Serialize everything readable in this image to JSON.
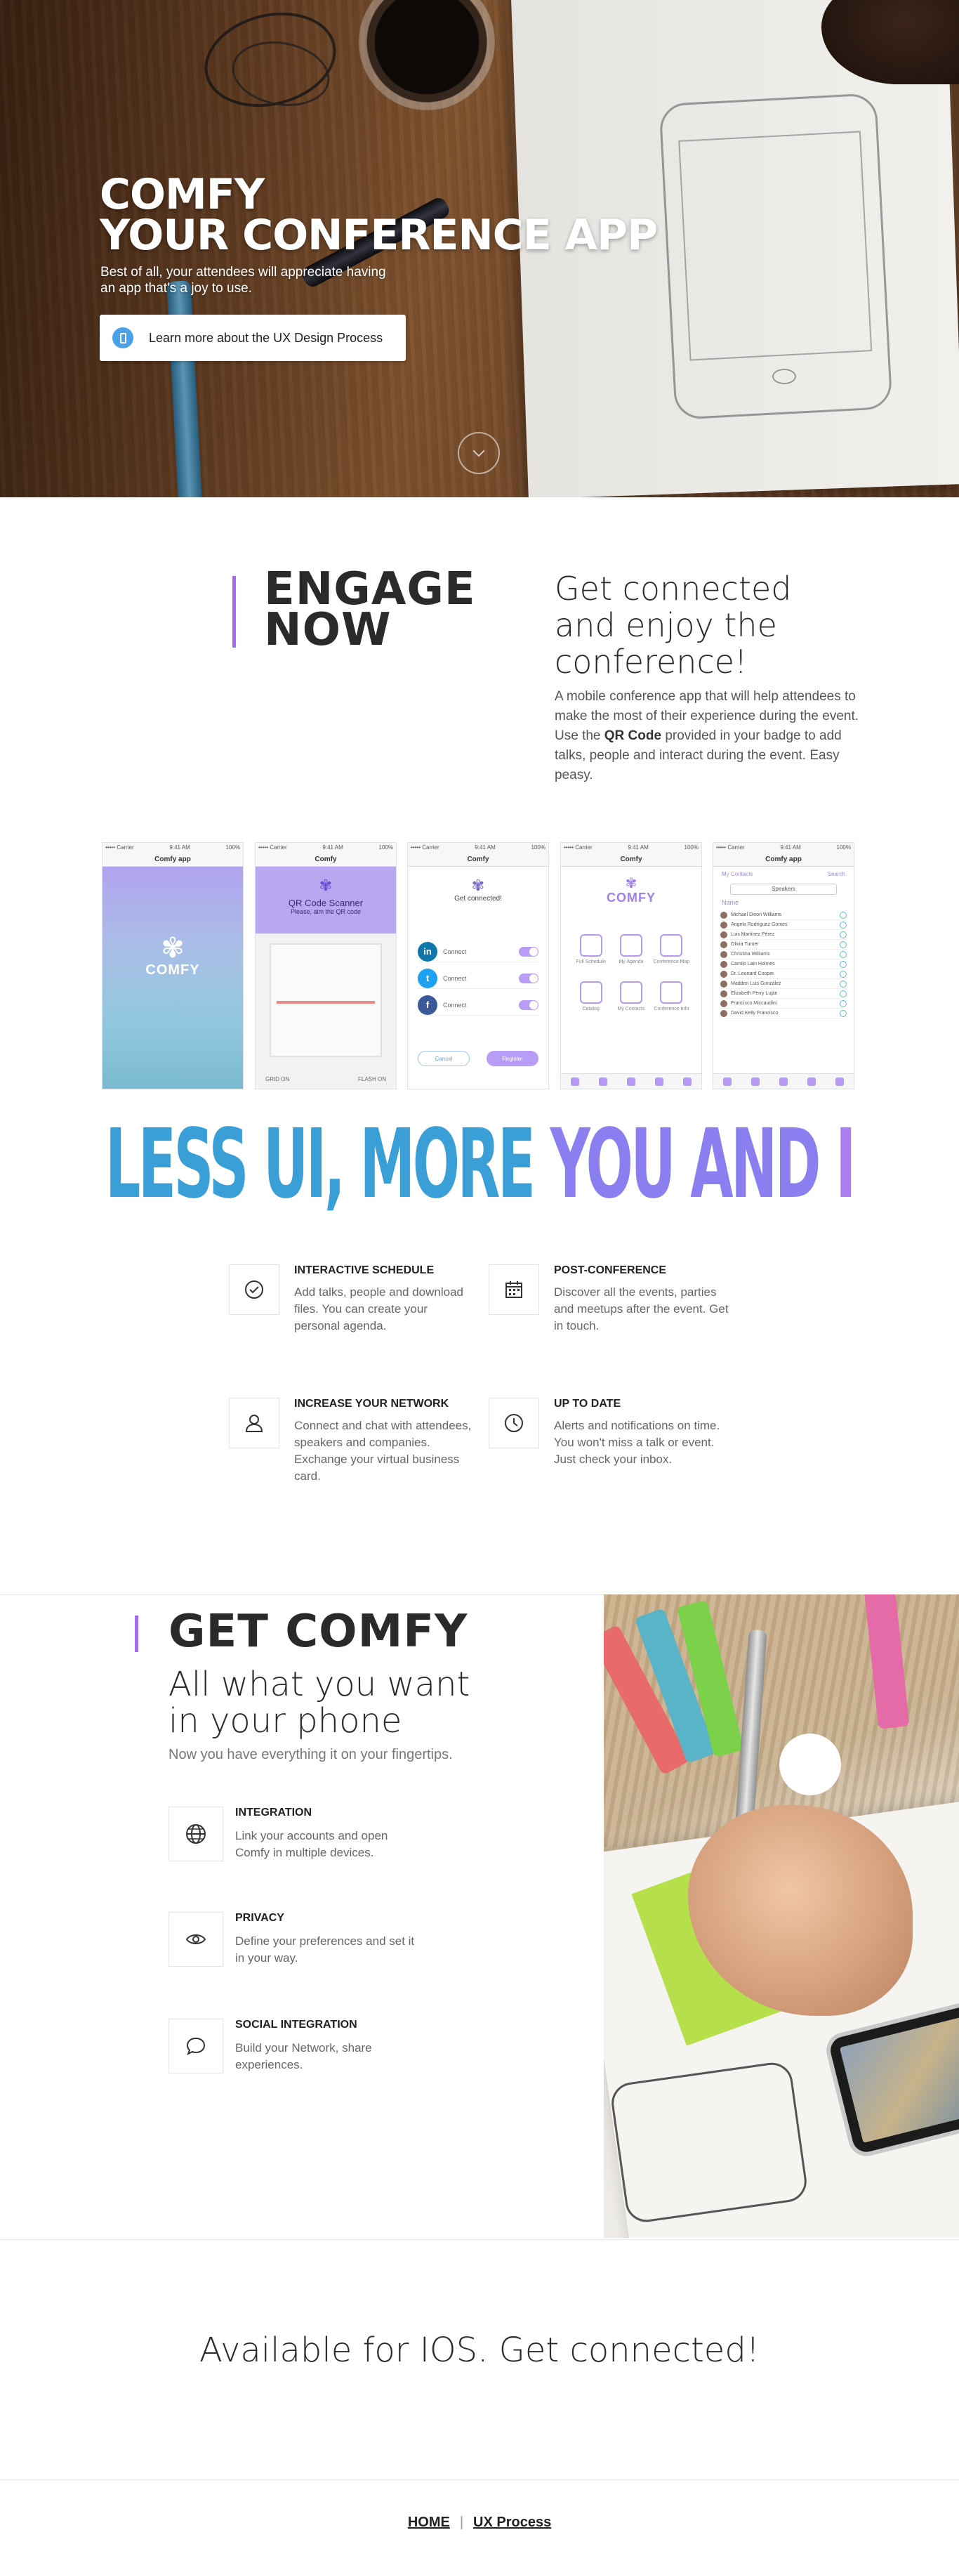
{
  "hero": {
    "title_line1": "COMFY",
    "title_line2": "YOUR CONFERENCE APP",
    "subtitle": "Best of all, your attendees will appreciate having an app that's a joy to use.",
    "cta_label": "Learn more about the UX Design Process",
    "cta_icon": "mobile-phone-icon",
    "scroll_icon": "chevron-down-icon"
  },
  "engage": {
    "title_line1": "ENGAGE",
    "title_line2": "NOW",
    "heading": "Get connected and enjoy the conference!",
    "text_before": "A mobile conference app that will help attendees to make the most of their experience during the event. Use the ",
    "text_bold": "QR Code",
    "text_after": " provided in your badge to add talks, people and interact during the event. Easy peasy.",
    "accent_color": "#a36cf0"
  },
  "screens": {
    "splash": {
      "status_left": "••••• Carrier",
      "status_time": "9:41 AM",
      "status_right": "100%",
      "nav_title": "Comfy app",
      "brand": "COMFY"
    },
    "scanner": {
      "status_left": "••••• Carrier",
      "status_time": "9:41 AM",
      "status_right": "100%",
      "nav_title": "Comfy",
      "title": "QR Code Scanner",
      "subtitle": "Please, aim the QR code",
      "left_action": "GRID ON",
      "right_action": "FLASH ON"
    },
    "connect": {
      "status_left": "••••• Carrier",
      "status_time": "9:41 AM",
      "status_right": "100%",
      "nav_title": "Comfy",
      "heading": "Get connected!",
      "rows": [
        {
          "network": "in",
          "label": "Connect",
          "color": "#0e76a8"
        },
        {
          "network": "t",
          "label": "Connect",
          "color": "#1da1f2"
        },
        {
          "network": "f",
          "label": "Connect",
          "color": "#3b5998"
        }
      ],
      "cancel": "Cancel",
      "register": "Register"
    },
    "home": {
      "status_left": "••••• Carrier",
      "status_time": "9:41 AM",
      "status_right": "100%",
      "nav_title": "Comfy",
      "brand": "COMFY",
      "tiles": [
        "Full Schedule",
        "My Agenda",
        "Conference Map",
        "Catalog",
        "My Contacts",
        "Conference Info"
      ]
    },
    "contacts": {
      "status_left": "••••• Carrier",
      "status_time": "9:41 AM",
      "status_right": "100%",
      "nav_title": "Comfy app",
      "search_label": "My Contacts",
      "search_right": "Search",
      "segment": "Speakers",
      "list_header": "Name",
      "people": [
        "Michael Dixon Williams",
        "Angela Rodríguez Gomes",
        "Luis Martínez Pérez",
        "Olivia Turner",
        "Christina Williams",
        "Camilo Lain Holmes",
        "Dr. Leonard Cooper",
        "Madden Luis González",
        "Elizabeth Perry Luján",
        "Francisco Miccaudini",
        "David Kelly Francisco"
      ]
    }
  },
  "slogan": {
    "part1": "LESS UI, MORE ",
    "part2": "YOU AND ",
    "part3": "I",
    "color1": "#3a9fd6",
    "color2": "#8a7ef0",
    "color3": "#a87ef0"
  },
  "features": [
    {
      "icon": "check-circle-icon",
      "title": "INTERACTIVE SCHEDULE",
      "text": "Add talks, people and download files. You can create your personal agenda."
    },
    {
      "icon": "calendar-icon",
      "title": "POST-CONFERENCE",
      "text": "Discover all the events, parties and meetups after the event. Get in touch."
    },
    {
      "icon": "user-icon",
      "title": "INCREASE YOUR NETWORK",
      "text": "Connect and chat with attendees, speakers and companies. Exchange your virtual business card."
    },
    {
      "icon": "clock-icon",
      "title": "UP TO DATE",
      "text": "Alerts and notifications on time. You won't miss a talk or event. Just check your inbox."
    }
  ],
  "get_comfy": {
    "title": "GET COMFY",
    "heading": "All what you want in your phone",
    "subtitle": "Now you have everything it on your fingertips.",
    "items": [
      {
        "icon": "globe-icon",
        "title": "INTEGRATION",
        "text": "Link your accounts and open Comfy in multiple devices."
      },
      {
        "icon": "eye-icon",
        "title": "PRIVACY",
        "text": "Define your preferences and set it in your way."
      },
      {
        "icon": "speech-bubble-icon",
        "title": "SOCIAL INTEGRATION",
        "text": "Build your Network, share experiences."
      }
    ],
    "play_icon": "play-button-icon"
  },
  "available": "Available for IOS. Get connected!",
  "footer": {
    "home": "HOME",
    "separator": "|",
    "process": "UX Process"
  }
}
